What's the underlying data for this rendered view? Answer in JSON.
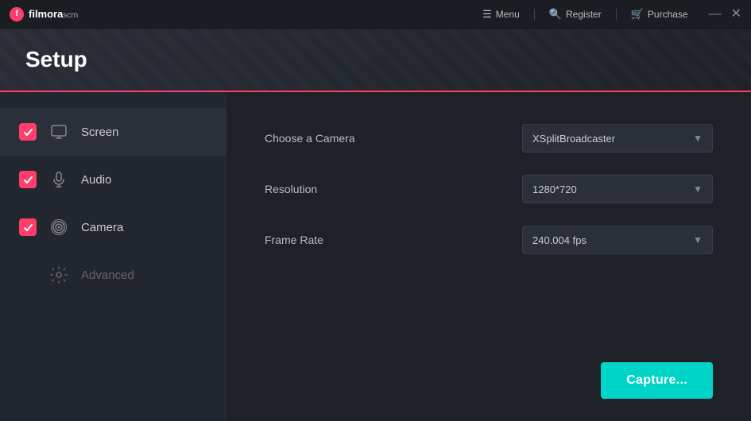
{
  "app": {
    "logo_brand": "filmora",
    "logo_scrn": "scrn",
    "logo_dot": "●"
  },
  "titlebar": {
    "menu_label": "Menu",
    "register_label": "Register",
    "purchase_label": "Purchase",
    "minimize_label": "—",
    "close_label": "✕"
  },
  "header": {
    "title": "Setup"
  },
  "sidebar": {
    "items": [
      {
        "id": "screen",
        "label": "Screen",
        "checked": true,
        "icon": "monitor"
      },
      {
        "id": "audio",
        "label": "Audio",
        "checked": true,
        "icon": "mic"
      },
      {
        "id": "camera",
        "label": "Camera",
        "checked": true,
        "icon": "camera"
      },
      {
        "id": "advanced",
        "label": "Advanced",
        "checked": false,
        "icon": "gear"
      }
    ]
  },
  "settings": {
    "camera_label": "Choose a Camera",
    "camera_value": "XSplitBroadcaster",
    "resolution_label": "Resolution",
    "resolution_value": "1280*720",
    "framerate_label": "Frame Rate",
    "framerate_value": "240.004 fps"
  },
  "capture_button_label": "Capture..."
}
